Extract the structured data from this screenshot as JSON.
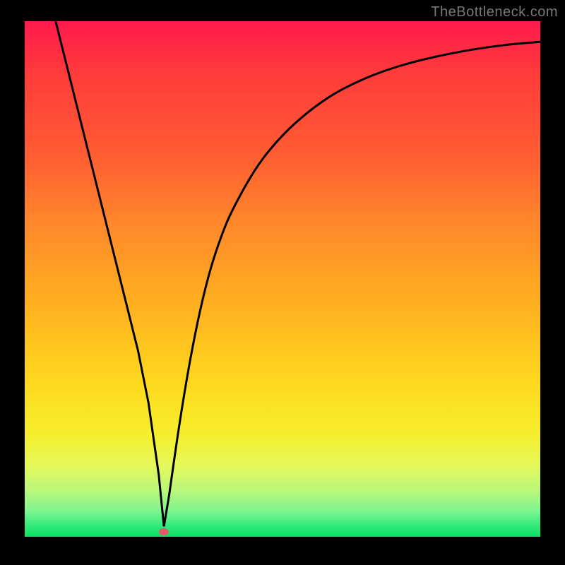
{
  "watermark": "TheBottleneck.com",
  "colors": {
    "curve": "#000000",
    "marker": "#e85a6b",
    "frame": "#000000"
  },
  "chart_data": {
    "type": "line",
    "title": "",
    "xlabel": "",
    "ylabel": "",
    "xlim": [
      0,
      100
    ],
    "ylim": [
      0,
      100
    ],
    "grid": false,
    "legend": false,
    "series": [
      {
        "name": "bottleneck-curve",
        "x": [
          6,
          8,
          10,
          12,
          14,
          16,
          18,
          20,
          22,
          24,
          26,
          27,
          28,
          30,
          32,
          34,
          36,
          38,
          40,
          45,
          50,
          55,
          60,
          65,
          70,
          75,
          80,
          85,
          90,
          95,
          100
        ],
        "y": [
          100,
          92,
          84,
          76,
          68,
          60,
          52,
          44,
          36,
          26,
          12,
          2,
          8,
          22,
          34,
          44,
          52,
          58,
          63,
          72,
          78,
          82.5,
          86,
          88.5,
          90.5,
          92,
          93.2,
          94.2,
          95,
          95.6,
          96
        ]
      }
    ],
    "marker": {
      "x": 27,
      "y": 1,
      "note": "vertex / optimal point"
    },
    "gradient_stops": [
      {
        "pos": 0,
        "color": "#ff1a4d"
      },
      {
        "pos": 25,
        "color": "#ff5a33"
      },
      {
        "pos": 55,
        "color": "#ffb020"
      },
      {
        "pos": 80,
        "color": "#f6ee2c"
      },
      {
        "pos": 100,
        "color": "#0be060"
      }
    ]
  }
}
